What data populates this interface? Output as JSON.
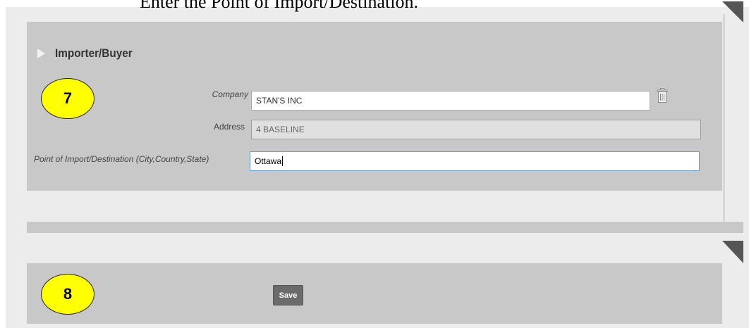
{
  "caption": "Enter the Point of Import/Destination.",
  "importer_panel": {
    "title": "Importer/Buyer",
    "step_number": "7",
    "company_label": "Company",
    "company_value": "STAN'S INC",
    "address_label": "Address",
    "address_value": "4 BASELINE",
    "poi_label": "Point of Import/Destination (City,Country,State)",
    "poi_value": "Ottawa"
  },
  "save_panel": {
    "step_number": "8",
    "save_label": "Save"
  },
  "icons": {
    "section_toggle": "triangle-right-icon",
    "delete": "trash-icon",
    "corners": "corner-triangle-icon"
  },
  "colors": {
    "panel": "#c8c8c8",
    "page": "#ececec",
    "step_badge": "#ffff00",
    "focus_border": "#6e9bd6",
    "button": "#6b6b6b"
  }
}
